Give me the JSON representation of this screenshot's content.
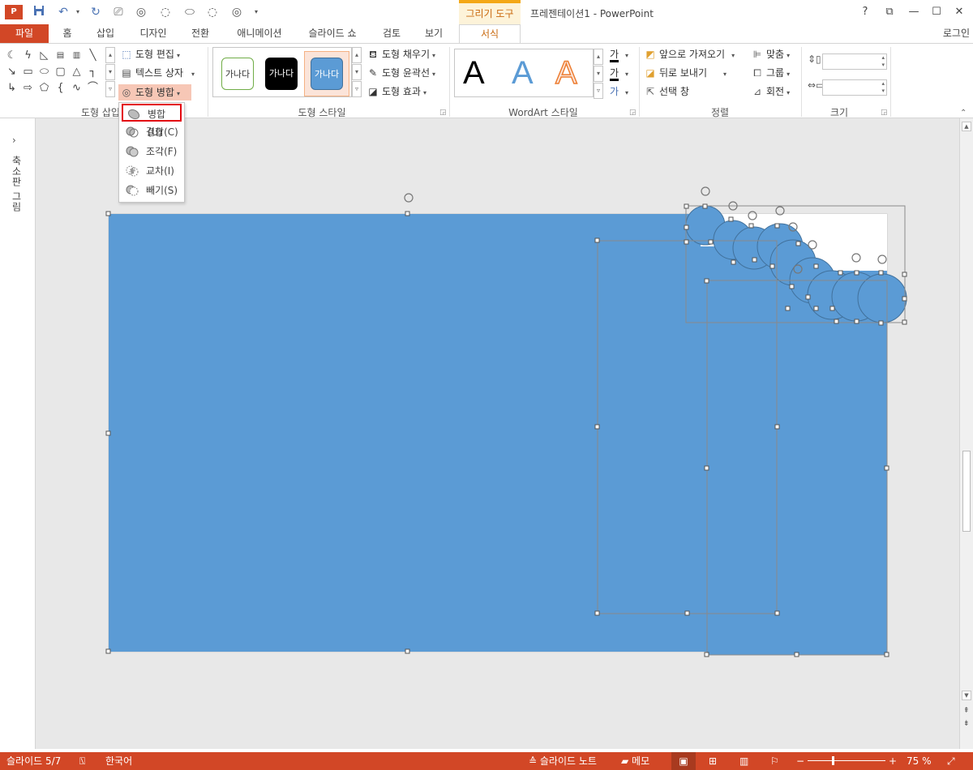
{
  "titlebar": {
    "context_label": "그리기 도구",
    "app_title": "프레젠테이션1 - PowerPoint",
    "help": "?",
    "ribbon_display": "⧉",
    "minimize": "—",
    "maximize": "☐",
    "close": "✕"
  },
  "tabs": [
    {
      "label": "파일"
    },
    {
      "label": "홈"
    },
    {
      "label": "삽입"
    },
    {
      "label": "디자인"
    },
    {
      "label": "전환"
    },
    {
      "label": "애니메이션"
    },
    {
      "label": "슬라이드 쇼"
    },
    {
      "label": "검토"
    },
    {
      "label": "보기"
    },
    {
      "label": "서식"
    }
  ],
  "login": "로그인",
  "ribbon": {
    "insert_shapes": {
      "label": "도형 삽입",
      "edit_shape": "도형 편집",
      "text_box": "텍스트 상자",
      "merge_shapes": "도형 병합"
    },
    "shape_styles": {
      "label": "도형 스타일",
      "presets": [
        "가나다",
        "가나다",
        "가나다"
      ],
      "fill": "도형 채우기",
      "outline": "도형 윤곽선",
      "effects": "도형 효과"
    },
    "wordart": {
      "label": "WordArt 스타일",
      "samples": [
        "A",
        "A",
        "A"
      ],
      "text_fill_glyph": "가",
      "text_outline_glyph": "가",
      "text_effect_glyph": "가"
    },
    "arrange": {
      "label": "정렬",
      "bring_forward": "앞으로 가져오기",
      "send_backward": "뒤로 보내기",
      "selection_pane": "선택 창",
      "align": "맞춤",
      "group": "그룹",
      "rotate": "회전"
    },
    "size": {
      "label": "크기",
      "height_value": "",
      "width_value": ""
    }
  },
  "merge_menu": {
    "items": [
      {
        "label": "병합(U)",
        "selected": true
      },
      {
        "label": "결합(C)"
      },
      {
        "label": "조각(F)"
      },
      {
        "label": "교차(I)"
      },
      {
        "label": "빼기(S)"
      }
    ]
  },
  "thumb_panel": {
    "label": "축소판 그림"
  },
  "statusbar": {
    "slide": "슬라이드 5/7",
    "language": "한국어",
    "notes": "슬라이드 노트",
    "comments": "메모",
    "zoom_minus": "−",
    "zoom_plus": "+",
    "zoom": "75 %"
  },
  "colors": {
    "accent": "#d24726",
    "shape_fill": "#5b9bd5",
    "context_tab": "#f4a817",
    "highlight_border": "#e3000f"
  }
}
